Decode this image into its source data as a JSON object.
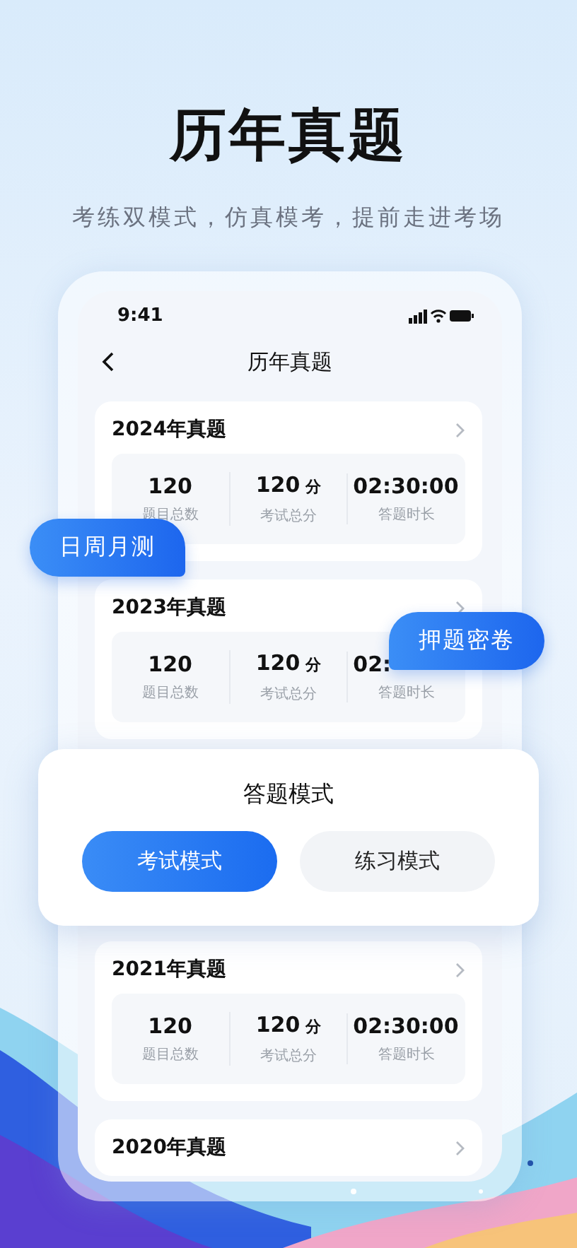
{
  "headline": "历年真题",
  "subtitle": "考练双模式，仿真模考，提前走进考场",
  "status_bar": {
    "time": "9:41"
  },
  "nav": {
    "title": "历年真题"
  },
  "papers": [
    {
      "title": "2024年真题",
      "stats": [
        {
          "value": "120",
          "label": "题目总数"
        },
        {
          "value": "120",
          "unit": "分",
          "label": "考试总分"
        },
        {
          "value": "02:30:00",
          "label": "答题时长"
        }
      ]
    },
    {
      "title": "2023年真题",
      "stats": [
        {
          "value": "120",
          "label": "题目总数"
        },
        {
          "value": "120",
          "unit": "分",
          "label": "考试总分"
        },
        {
          "value": "02:",
          "label": "答题时长"
        }
      ]
    },
    {
      "kind": "hidden"
    },
    {
      "title": "2021年真题",
      "stats": [
        {
          "value": "120",
          "label": "题目总数"
        },
        {
          "value": "120",
          "unit": "分",
          "label": "考试总分"
        },
        {
          "value": "02:30:00",
          "label": "答题时长"
        }
      ]
    },
    {
      "title": "2020年真题"
    }
  ],
  "badges": [
    {
      "label": "日周月测"
    },
    {
      "label": "押题密卷"
    }
  ],
  "mode_dialog": {
    "title": "答题模式",
    "options": [
      {
        "label": "考试模式",
        "selected": true
      },
      {
        "label": "练习模式",
        "selected": false
      }
    ]
  }
}
